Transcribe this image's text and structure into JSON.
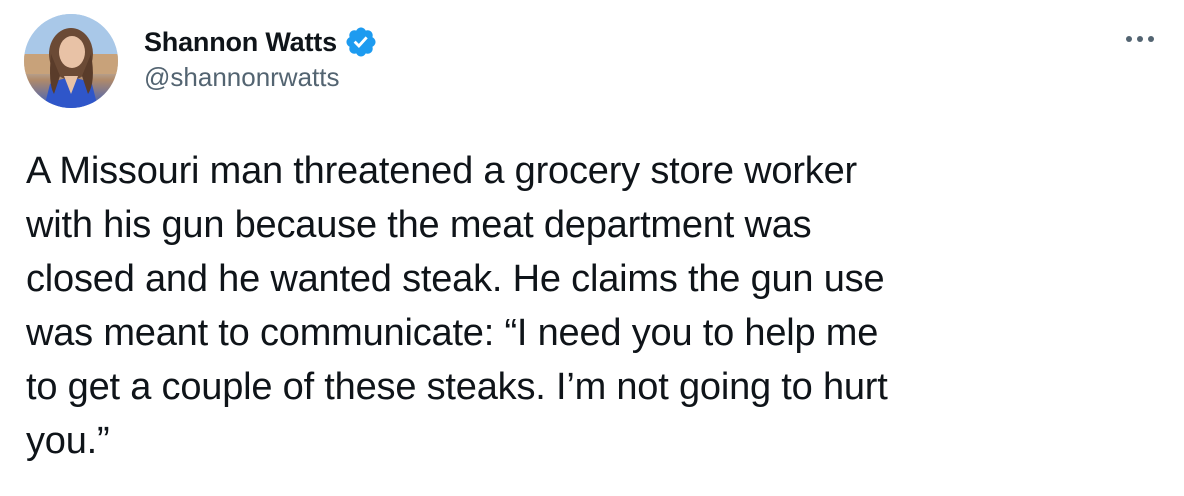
{
  "author": {
    "display_name": "Shannon Watts",
    "handle": "@shannonrwatts",
    "verified": true,
    "avatar_icon": "profile-photo"
  },
  "tweet": {
    "text": "A Missouri man threatened a grocery store worker\nwith his gun because the meat department was\nclosed and he wanted steak. He claims the gun use\nwas meant to communicate: “I need you to help me\nto get a couple of these steaks. I’m not going to hurt\nyou.”"
  },
  "icons": {
    "verified": "verified-badge-icon",
    "more": "more-options-icon"
  },
  "colors": {
    "text_primary": "#0f1419",
    "text_secondary": "#536471",
    "verified_blue": "#1d9bf0",
    "background": "#ffffff"
  }
}
